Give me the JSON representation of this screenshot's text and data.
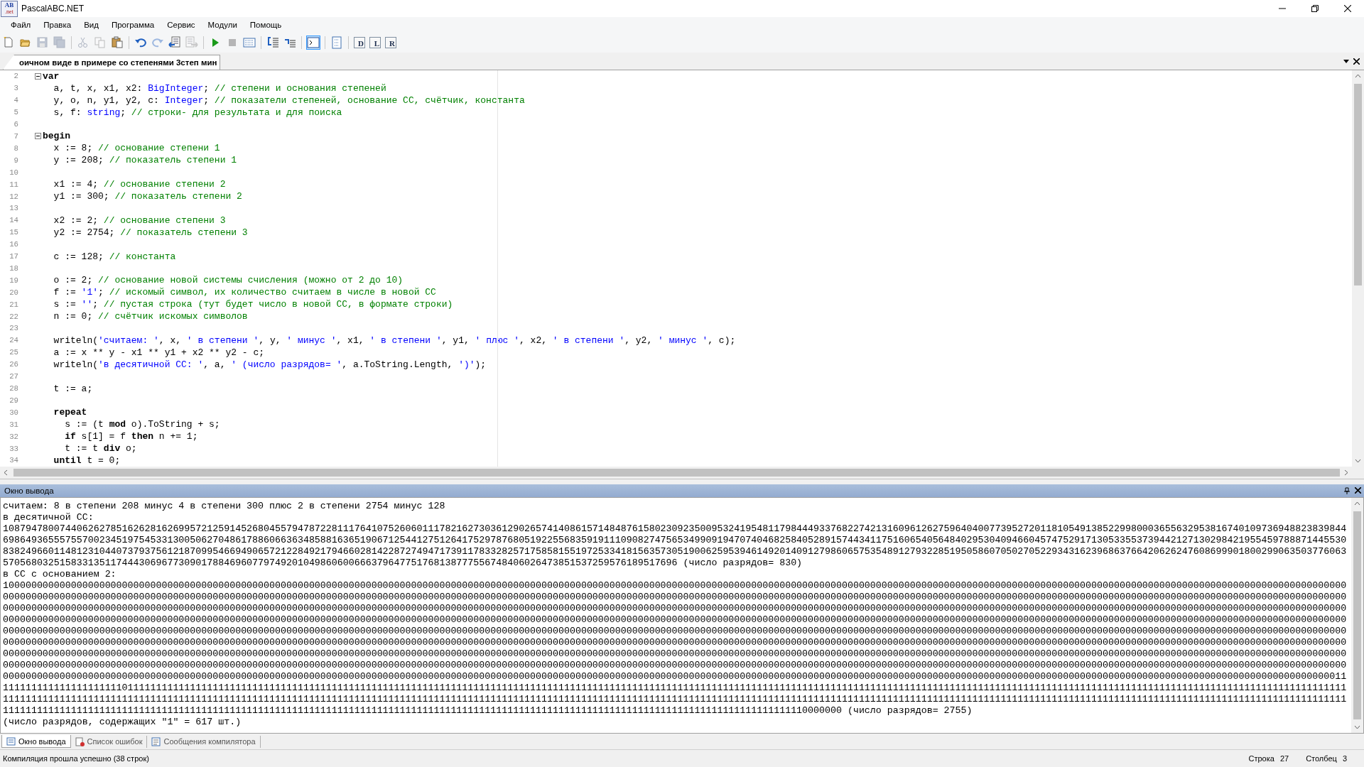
{
  "window": {
    "title": "PascalABC.NET",
    "logo": {
      "top": "AB",
      "bottom": ".net"
    }
  },
  "menu": [
    "Файл",
    "Правка",
    "Вид",
    "Программа",
    "Сервис",
    "Модули",
    "Помощь"
  ],
  "toolbar": [
    {
      "kind": "new",
      "disabled": false,
      "pressed": false
    },
    {
      "kind": "open",
      "disabled": false,
      "pressed": false
    },
    {
      "kind": "save",
      "disabled": true,
      "pressed": false
    },
    {
      "kind": "save-all",
      "disabled": true,
      "pressed": false
    },
    {
      "kind": "separator"
    },
    {
      "kind": "cut",
      "disabled": true,
      "pressed": false
    },
    {
      "kind": "copy",
      "disabled": true,
      "pressed": false
    },
    {
      "kind": "paste",
      "disabled": false,
      "pressed": false
    },
    {
      "kind": "separator"
    },
    {
      "kind": "undo",
      "disabled": false,
      "pressed": false
    },
    {
      "kind": "redo",
      "disabled": true,
      "pressed": false
    },
    {
      "kind": "doc-left",
      "disabled": false,
      "pressed": false
    },
    {
      "kind": "doc-right",
      "disabled": true,
      "pressed": false
    },
    {
      "kind": "separator"
    },
    {
      "kind": "run",
      "disabled": false,
      "pressed": false
    },
    {
      "kind": "stop",
      "disabled": true,
      "pressed": false
    },
    {
      "kind": "grid",
      "disabled": false,
      "pressed": false
    },
    {
      "kind": "separator"
    },
    {
      "kind": "lines-left",
      "disabled": false,
      "pressed": false
    },
    {
      "kind": "lines-right",
      "disabled": false,
      "pressed": false
    },
    {
      "kind": "separator"
    },
    {
      "kind": "console",
      "disabled": false,
      "pressed": true
    },
    {
      "kind": "separator"
    },
    {
      "kind": "page",
      "disabled": false,
      "pressed": false
    },
    {
      "kind": "separator"
    },
    {
      "kind": "letter",
      "label": "D",
      "disabled": false,
      "pressed": false
    },
    {
      "kind": "letter",
      "label": "L",
      "disabled": false,
      "pressed": false
    },
    {
      "kind": "letter",
      "label": "R",
      "disabled": false,
      "pressed": false
    }
  ],
  "tabs": [
    {
      "label": "оичном виде в примере со степенями 3степ мин",
      "selected": true
    }
  ],
  "editor": {
    "lines": [
      {
        "number": "2",
        "fold": {
          "expanded": true
        },
        "tokens": [
          {
            "kind": "keyword",
            "text": "var"
          }
        ]
      },
      {
        "number": "3",
        "tokens": [
          {
            "kind": "text",
            "text": "  a, t, x, x1, x2: "
          },
          {
            "kind": "type",
            "text": "BigInteger"
          },
          {
            "kind": "text",
            "text": "; "
          },
          {
            "kind": "comment",
            "text": "// степени и основания степеней"
          }
        ]
      },
      {
        "number": "4",
        "tokens": [
          {
            "kind": "text",
            "text": "  y, o, n, y1, y2, c: "
          },
          {
            "kind": "type",
            "text": "Integer"
          },
          {
            "kind": "text",
            "text": "; "
          },
          {
            "kind": "comment",
            "text": "// показатели степеней, основание СС, счётчик, константа"
          }
        ]
      },
      {
        "number": "5",
        "tokens": [
          {
            "kind": "text",
            "text": "  s, f: "
          },
          {
            "kind": "type",
            "text": "string"
          },
          {
            "kind": "text",
            "text": "; "
          },
          {
            "kind": "comment",
            "text": "// строки- для результата и для поиска"
          }
        ]
      },
      {
        "number": "6"
      },
      {
        "number": "7",
        "fold": {
          "expanded": true
        },
        "tokens": [
          {
            "kind": "keyword",
            "text": "begin"
          }
        ]
      },
      {
        "number": "8",
        "tokens": [
          {
            "kind": "text",
            "text": "  x := 8; "
          },
          {
            "kind": "comment",
            "text": "// основание степени 1"
          }
        ]
      },
      {
        "number": "9",
        "tokens": [
          {
            "kind": "text",
            "text": "  y := 208; "
          },
          {
            "kind": "comment",
            "text": "// показатель степени 1"
          }
        ]
      },
      {
        "number": "10"
      },
      {
        "number": "11",
        "tokens": [
          {
            "kind": "text",
            "text": "  x1 := 4; "
          },
          {
            "kind": "comment",
            "text": "// основание степени 2"
          }
        ]
      },
      {
        "number": "12",
        "tokens": [
          {
            "kind": "text",
            "text": "  y1 := 300; "
          },
          {
            "kind": "comment",
            "text": "// показатель степени 2"
          }
        ]
      },
      {
        "number": "13"
      },
      {
        "number": "14",
        "tokens": [
          {
            "kind": "text",
            "text": "  x2 := 2; "
          },
          {
            "kind": "comment",
            "text": "// основание степени 3"
          }
        ]
      },
      {
        "number": "15",
        "tokens": [
          {
            "kind": "text",
            "text": "  y2 := 2754; "
          },
          {
            "kind": "comment",
            "text": "// показатель степени 3"
          }
        ]
      },
      {
        "number": "16"
      },
      {
        "number": "17",
        "tokens": [
          {
            "kind": "text",
            "text": "  c := 128; "
          },
          {
            "kind": "comment",
            "text": "// константа"
          }
        ]
      },
      {
        "number": "18"
      },
      {
        "number": "19",
        "tokens": [
          {
            "kind": "text",
            "text": "  o := 2; "
          },
          {
            "kind": "comment",
            "text": "// основание новой системы счисления (можно от 2 до 10)"
          }
        ]
      },
      {
        "number": "20",
        "tokens": [
          {
            "kind": "text",
            "text": "  f := "
          },
          {
            "kind": "string",
            "text": "'1'"
          },
          {
            "kind": "text",
            "text": "; "
          },
          {
            "kind": "comment",
            "text": "// искомый символ, их количество считаем в числе в новой СС"
          }
        ]
      },
      {
        "number": "21",
        "tokens": [
          {
            "kind": "text",
            "text": "  s := "
          },
          {
            "kind": "string",
            "text": "''"
          },
          {
            "kind": "text",
            "text": "; "
          },
          {
            "kind": "comment",
            "text": "// пустая строка (тут будет число в новой СС, в формате строки)"
          }
        ]
      },
      {
        "number": "22",
        "tokens": [
          {
            "kind": "text",
            "text": "  n := 0; "
          },
          {
            "kind": "comment",
            "text": "// счётчик искомых символов"
          }
        ]
      },
      {
        "number": "23"
      },
      {
        "number": "24",
        "tokens": [
          {
            "kind": "text",
            "text": "  writeln("
          },
          {
            "kind": "string",
            "text": "'считаем: '"
          },
          {
            "kind": "text",
            "text": ", x, "
          },
          {
            "kind": "string",
            "text": "' в степени '"
          },
          {
            "kind": "text",
            "text": ", y, "
          },
          {
            "kind": "string",
            "text": "' минус '"
          },
          {
            "kind": "text",
            "text": ", x1, "
          },
          {
            "kind": "string",
            "text": "' в степени '"
          },
          {
            "kind": "text",
            "text": ", y1, "
          },
          {
            "kind": "string",
            "text": "' плюс '"
          },
          {
            "kind": "text",
            "text": ", x2, "
          },
          {
            "kind": "string",
            "text": "' в степени '"
          },
          {
            "kind": "text",
            "text": ", y2, "
          },
          {
            "kind": "string",
            "text": "' минус '"
          },
          {
            "kind": "text",
            "text": ", c);"
          }
        ]
      },
      {
        "number": "25",
        "tokens": [
          {
            "kind": "text",
            "text": "  a := x ** y - x1 ** y1 + x2 ** y2 - c;"
          }
        ]
      },
      {
        "number": "26",
        "tokens": [
          {
            "kind": "text",
            "text": "  writeln("
          },
          {
            "kind": "string",
            "text": "'в десятичной СС: '"
          },
          {
            "kind": "text",
            "text": ", a, "
          },
          {
            "kind": "string",
            "text": "' (число разрядов= '"
          },
          {
            "kind": "text",
            "text": ", a.ToString.Length, "
          },
          {
            "kind": "string",
            "text": "')'"
          },
          {
            "kind": "text",
            "text": ");"
          }
        ]
      },
      {
        "number": "27"
      },
      {
        "number": "28",
        "tokens": [
          {
            "kind": "text",
            "text": "  t := a;"
          }
        ]
      },
      {
        "number": "29"
      },
      {
        "number": "30",
        "tokens": [
          {
            "kind": "keyword",
            "text": "  repeat"
          }
        ]
      },
      {
        "number": "31",
        "tokens": [
          {
            "kind": "text",
            "text": "    s := (t "
          },
          {
            "kind": "keyword",
            "text": "mod"
          },
          {
            "kind": "text",
            "text": " o).ToString + s;"
          }
        ]
      },
      {
        "number": "32",
        "tokens": [
          {
            "kind": "keyword",
            "text": "    if"
          },
          {
            "kind": "text",
            "text": " s[1] = f "
          },
          {
            "kind": "keyword",
            "text": "then"
          },
          {
            "kind": "text",
            "text": " n += 1;"
          }
        ]
      },
      {
        "number": "33",
        "tokens": [
          {
            "kind": "text",
            "text": "    t := t "
          },
          {
            "kind": "keyword",
            "text": "div"
          },
          {
            "kind": "text",
            "text": " o;"
          }
        ]
      },
      {
        "number": "34",
        "tokens": [
          {
            "kind": "keyword",
            "text": "  until"
          },
          {
            "kind": "text",
            "text": " t = 0;"
          }
        ]
      }
    ]
  },
  "output": {
    "title": "Окно вывода",
    "lines": [
      "считаем: 8 в степени 208 минус 4 в степени 300 плюс 2 в степени 2754 минус 128",
      "в десятичной СС:",
      "108794780074406262785162628162699572125914526804557947872281117641075260601117821627303612902657414086157148487615802309235009532419548117984449337682274213160961262759640400773952720118105491385229980003655632953816740109736948823839844",
      "698649365557557002345197545331300506270486178860663634858816365190671254412751264175297876805192255683591911109082747565349909194707404682584052891574434117516065405648402953040946604574752917130533553739442127130298421955459788871445530",
      "838249660114812310440737937561218709954669490657212284921794660281422872749471739117833282571758581551972533418156357305190062595394614920140912798606575354891279322851950586070502705229343162396863766420626247608699901800299063503776063",
      "57056803251583313511744430696773090178846960779749201049860600666379647751768138777556748406026473851537259576189517696 (число разрядов= 830)",
      "в СС с основанием 2:",
      "100000000000000000000000000000000000000000000000000000000000000000000000000000000000000000000000000000000000000000000000000000000000000000000000000000000000000000000000000000000000000000000000000000000000000000000000000000000000000000000",
      "000000000000000000000000000000000000000000000000000000000000000000000000000000000000000000000000000000000000000000000000000000000000000000000000000000000000000000000000000000000000000000000000000000000000000000000000000000000000000000000",
      "000000000000000000000000000000000000000000000000000000000000000000000000000000000000000000000000000000000000000000000000000000000000000000000000000000000000000000000000000000000000000000000000000000000000000000000000000000000000000000000",
      "000000000000000000000000000000000000000000000000000000000000000000000000000000000000000000000000000000000000000000000000000000000000000000000000000000000000000000000000000000000000000000000000000000000000000000000000000000000000000000000",
      "000000000000000000000000000000000000000000000000000000000000000000000000000000000000000000000000000000000000000000000000000000000000000000000000000000000000000000000000000000000000000000000000000000000000000000000000000000000000000000000",
      "000000000000000000000000000000000000000000000000000000000000000000000000000000000000000000000000000000000000000000000000000000000000000000000000000000000000000000000000000000000000000000000000000000000000000000000000000000000000000000000",
      "000000000000000000000000000000000000000000000000000000000000000000000000000000000000000000000000000000000000000000000000000000000000000000000000000000000000000000000000000000000000000000000000000000000000000000000000000000000000000000000",
      "000000000000000000000000000000000000000000000000000000000000000000000000000000000000000000000000000000000000000000000000000000000000000000000000000000000000000000000000000000000000000000000000000000000000000000000000000000000000000000000",
      "000000000000000000000000000000000000000000000000000000000000000000000000000000000000000000000000000000000000000000000000000000000000000000000000000000000000000000000000000000000000000000000000000000000000000000000000000000000000000000011",
      "111111111111111111111011111111111111111111111111111111111111111111111111111111111111111111111111111111111111111111111111111111111111111111111111111111111111111111111111111111111111111111111111111111111111111111111111111111111111111111111",
      "111111111111111111111111111111111111111111111111111111111111111111111111111111111111111111111111111111111111111111111111111111111111111111111111111111111111111111111111111111111111111111111111111111111111111111111111111111111111111111111",
      "1111111111111111111111111111111111111111111111111111111111111111111111111111111111111111111111111111111111111111111111111111111111111111111110000000 (число разрядов= 2755)",
      "(число разрядов, содержащих \"1\" = 617 шт.)"
    ]
  },
  "bottom_tabs": [
    {
      "label": "Окно вывода",
      "kind": "output",
      "selected": true
    },
    {
      "label": "Список ошибок",
      "kind": "errors",
      "selected": false
    },
    {
      "label": "Сообщения компилятора",
      "kind": "messages",
      "selected": false
    }
  ],
  "status_bar": {
    "message": "Компиляция прошла успешно (38 строк)",
    "fields": [
      {
        "label": "Строка",
        "value": "27"
      },
      {
        "label": "Столбец",
        "value": "3"
      }
    ]
  }
}
